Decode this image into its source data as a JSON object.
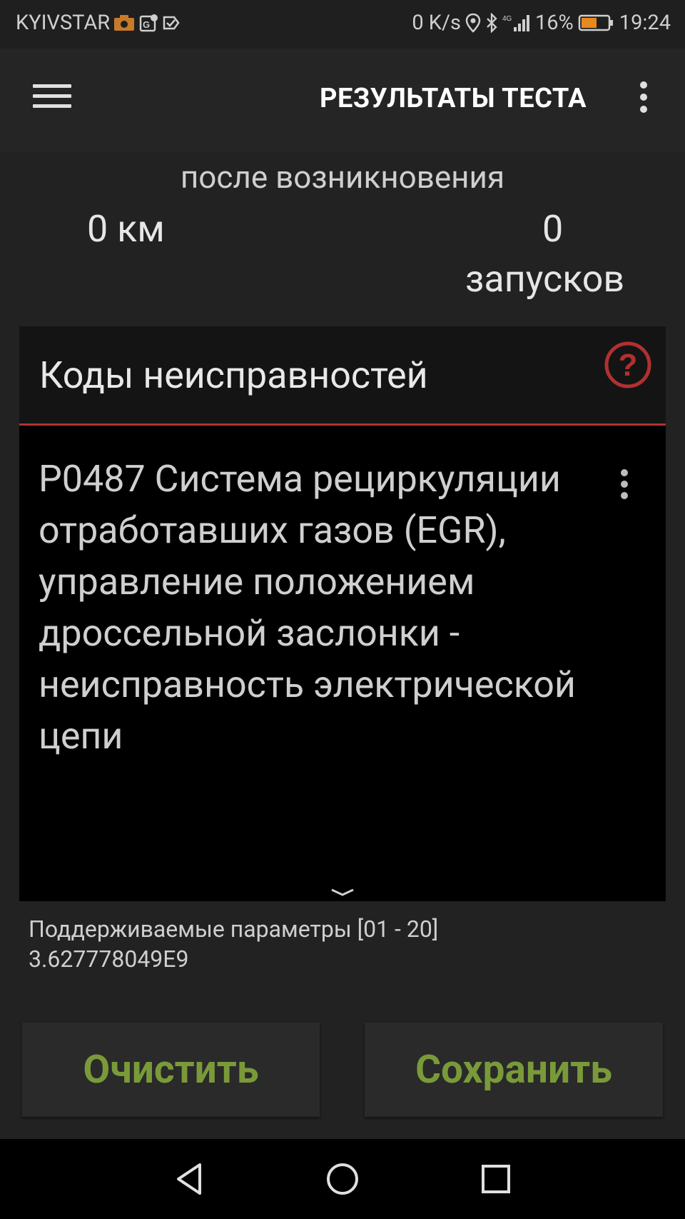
{
  "status_bar": {
    "carrier": "KYIVSTAR",
    "net_speed": "0 K/s",
    "network_type": "4G",
    "battery_percent": "16%",
    "battery_level": 0.16,
    "time": "19:24"
  },
  "app_bar": {
    "title": "РЕЗУЛЬТАТЫ ТЕСТА",
    "menu_icon": "hamburger-menu-icon",
    "overflow_icon": "more-vert-icon"
  },
  "summary": {
    "after_label": "после возникновения",
    "distance": "0 км",
    "starts_count": "0",
    "starts_label": "запусков"
  },
  "codes": {
    "header": "Коды неисправностей",
    "help_icon": "help-icon",
    "accent_color": "#b23030",
    "items": [
      {
        "text": "P0487 Система рециркуляции отработавших газов (EGR), управление положением дроссельной заслонки - неисправность электрической цепи"
      }
    ]
  },
  "params": {
    "label": "Поддерживаемые параметры [01 - 20]",
    "value": "3.627778049E9"
  },
  "buttons": {
    "clear": "Очистить",
    "save": "Сохранить",
    "color": "#7a9a3a"
  },
  "nav_bar": {
    "back_icon": "back-triangle-icon",
    "home_icon": "home-circle-icon",
    "recents_icon": "recents-square-icon"
  }
}
